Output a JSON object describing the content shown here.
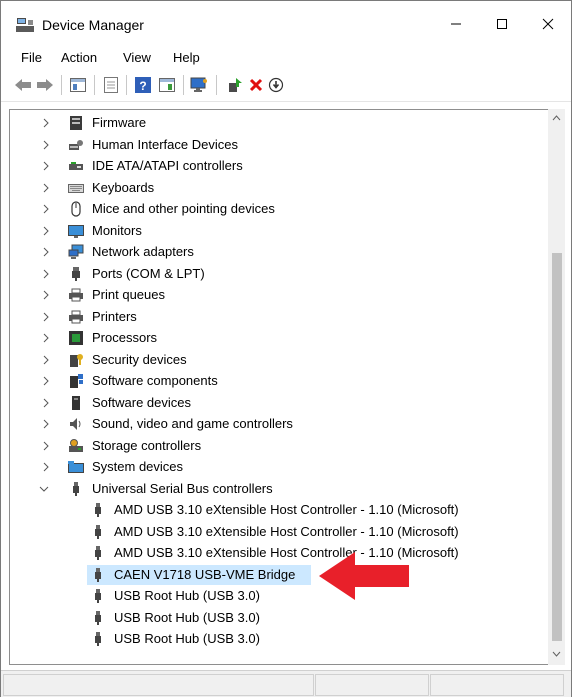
{
  "window": {
    "title": "Device Manager",
    "buttons": {
      "minimize": "—",
      "maximize": "☐",
      "close": "✕"
    }
  },
  "menu": [
    {
      "label": "File"
    },
    {
      "label": "Action"
    },
    {
      "label": "View"
    },
    {
      "label": "Help"
    }
  ],
  "toolbar": {
    "icons": [
      "back-icon",
      "forward-icon",
      "show-hide-console-tree-icon",
      "properties-icon",
      "help-icon",
      "action-pane-icon",
      "scan-hardware-icon",
      "update-driver-icon",
      "uninstall-icon",
      "disable-device-icon"
    ]
  },
  "tree": {
    "categories": [
      {
        "label": "Firmware",
        "icon": "firmware-icon",
        "expanded": false
      },
      {
        "label": "Human Interface Devices",
        "icon": "hid-icon",
        "expanded": false
      },
      {
        "label": "IDE ATA/ATAPI controllers",
        "icon": "ide-controller-icon",
        "expanded": false
      },
      {
        "label": "Keyboards",
        "icon": "keyboard-icon",
        "expanded": false
      },
      {
        "label": "Mice and other pointing devices",
        "icon": "mouse-icon",
        "expanded": false
      },
      {
        "label": "Monitors",
        "icon": "monitor-icon",
        "expanded": false
      },
      {
        "label": "Network adapters",
        "icon": "network-adapter-icon",
        "expanded": false
      },
      {
        "label": "Ports (COM & LPT)",
        "icon": "port-icon",
        "expanded": false
      },
      {
        "label": "Print queues",
        "icon": "print-queue-icon",
        "expanded": false
      },
      {
        "label": "Printers",
        "icon": "printer-icon",
        "expanded": false
      },
      {
        "label": "Processors",
        "icon": "processor-icon",
        "expanded": false
      },
      {
        "label": "Security devices",
        "icon": "security-device-icon",
        "expanded": false
      },
      {
        "label": "Software components",
        "icon": "software-component-icon",
        "expanded": false
      },
      {
        "label": "Software devices",
        "icon": "software-device-icon",
        "expanded": false
      },
      {
        "label": "Sound, video and game controllers",
        "icon": "sound-icon",
        "expanded": false
      },
      {
        "label": "Storage controllers",
        "icon": "storage-controller-icon",
        "expanded": false
      },
      {
        "label": "System devices",
        "icon": "system-device-icon",
        "expanded": false
      },
      {
        "label": "Universal Serial Bus controllers",
        "icon": "usb-icon",
        "expanded": true
      }
    ],
    "usb_children": [
      {
        "label": "AMD USB 3.10 eXtensible Host Controller - 1.10 (Microsoft)",
        "selected": false
      },
      {
        "label": "AMD USB 3.10 eXtensible Host Controller - 1.10 (Microsoft)",
        "selected": false
      },
      {
        "label": "AMD USB 3.10 eXtensible Host Controller - 1.10 (Microsoft)",
        "selected": false
      },
      {
        "label": "CAEN V1718 USB-VME Bridge",
        "selected": true
      },
      {
        "label": "USB Root Hub (USB 3.0)",
        "selected": false
      },
      {
        "label": "USB Root Hub (USB 3.0)",
        "selected": false
      },
      {
        "label": "USB Root Hub (USB 3.0)",
        "selected": false
      }
    ]
  },
  "annotation": {
    "icon": "red-arrow-icon",
    "color": "#e8202a"
  },
  "colors": {
    "selection": "#cce8ff",
    "accent_red": "#e8202a"
  }
}
